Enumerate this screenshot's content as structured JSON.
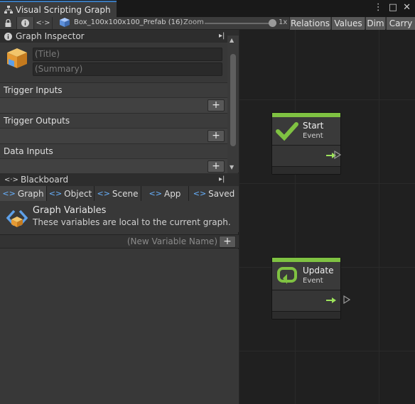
{
  "window": {
    "title": "Visual Scripting Graph",
    "controls": [
      "⋮",
      "□",
      "✕"
    ]
  },
  "toolbar": {
    "asset_name": "Box_100x100x100_Prefab (16)",
    "zoom_label": "Zoom",
    "zoom_value": "1x",
    "modes": [
      "Relations",
      "Values",
      "Dim",
      "Carry"
    ]
  },
  "inspector": {
    "header": "Graph Inspector",
    "title_placeholder": "(Title)",
    "summary_placeholder": "(Summary)",
    "sections": [
      {
        "label": "Trigger Inputs"
      },
      {
        "label": "Trigger Outputs"
      },
      {
        "label": "Data Inputs"
      }
    ]
  },
  "blackboard": {
    "header": "Blackboard",
    "tabs": [
      {
        "label": "Graph",
        "icon": "graph-variables-icon",
        "active": true
      },
      {
        "label": "Object",
        "icon": "object-variables-icon",
        "active": false
      },
      {
        "label": "Scene",
        "icon": "scene-variables-icon",
        "active": false
      },
      {
        "label": "App",
        "icon": "app-variables-icon",
        "active": false
      },
      {
        "label": "Saved",
        "icon": "saved-variables-icon",
        "active": false
      }
    ],
    "variables_title": "Graph Variables",
    "variables_desc": "These variables are local to the current graph.",
    "new_variable_placeholder": "(New Variable Name)",
    "add_label": "+"
  },
  "graph": {
    "nodes": [
      {
        "title": "Start",
        "subtitle": "Event",
        "icon": "check-icon"
      },
      {
        "title": "Update",
        "subtitle": "Event",
        "icon": "loop-icon"
      }
    ]
  },
  "colors": {
    "event_green": "#7fc242",
    "accent_blue": "#3a79bb",
    "canvas_bg": "#202020"
  }
}
